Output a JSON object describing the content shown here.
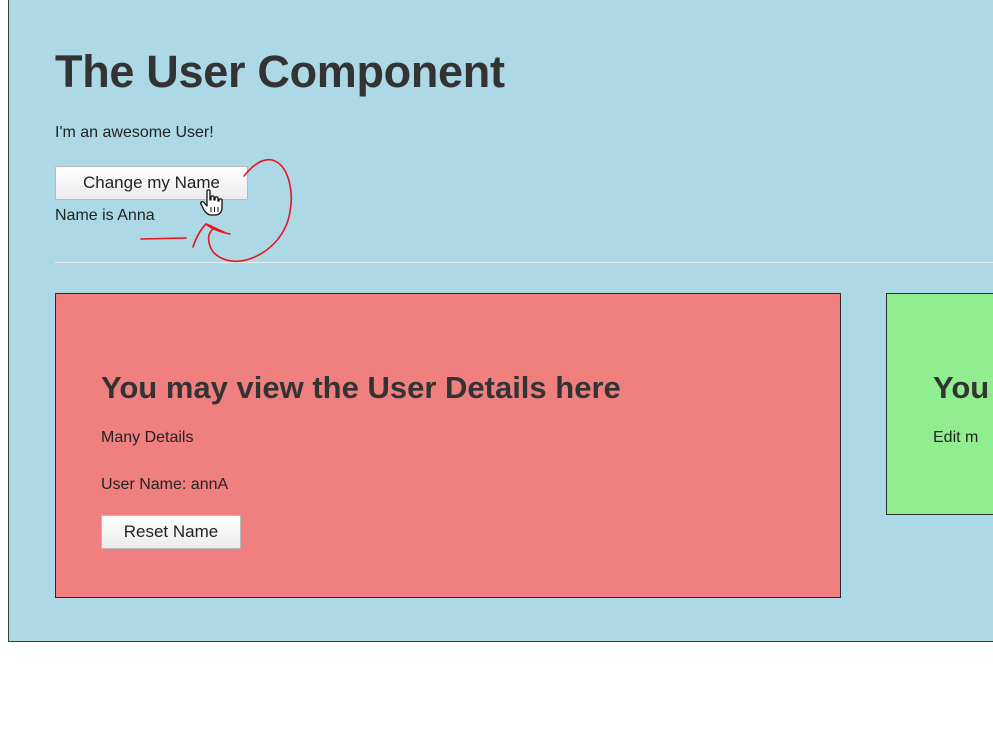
{
  "header": {
    "title": "The User Component",
    "subtitle": "I'm an awesome User!",
    "change_button_label": "Change my Name",
    "name_line": "Name is Anna"
  },
  "user_detail": {
    "title": "You may view the User Details here",
    "description": "Many Details",
    "user_name_line": "User Name: annA",
    "reset_button_label": "Reset Name"
  },
  "user_edit": {
    "title": "You",
    "description": "Edit m"
  },
  "colors": {
    "page_background": "#add8e6",
    "detail_card": "#f08080",
    "edit_card": "#90ee90",
    "annotation_ink": "#e8141b"
  },
  "icons": {
    "cursor": "hand-pointer-icon"
  }
}
